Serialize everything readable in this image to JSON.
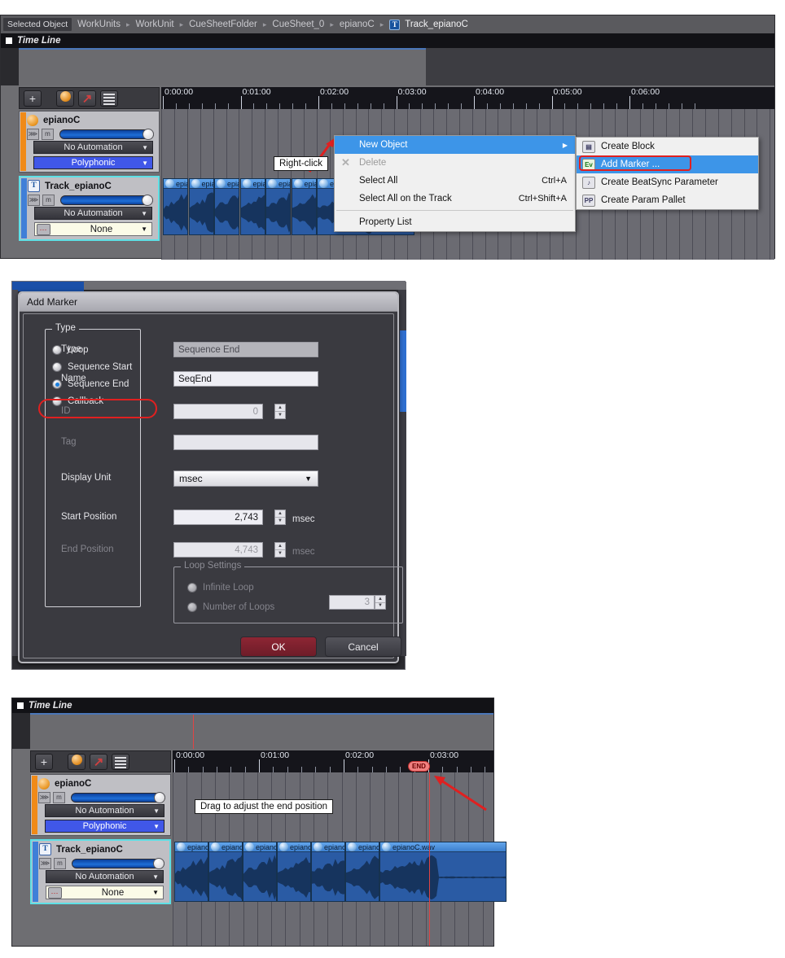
{
  "app": {
    "breadcrumb": {
      "chip": "Selected Object",
      "items": [
        "WorkUnits",
        "WorkUnit",
        "CueSheetFolder",
        "CueSheet_0",
        "epianoC"
      ],
      "separator": "▸",
      "current_icon": "T",
      "current": "Track_epianoC"
    },
    "timeline_title": "Time Line"
  },
  "toolbar": {
    "add_label": "+",
    "buttons": [
      "add-button",
      "voice-ball-button",
      "envelope-button",
      "list-button"
    ]
  },
  "ruler_top": {
    "labels": [
      "0:00:00",
      "0:01:00",
      "0:02:00",
      "0:03:00",
      "0:04:00",
      "0:05:00",
      "0:06:00"
    ]
  },
  "ruler_bottom": {
    "labels": [
      "0:00:00",
      "0:01:00",
      "0:02:00",
      "0:03:00"
    ]
  },
  "tracks_top": [
    {
      "name": "epianoC",
      "icon": "voice-ball-icon",
      "accent": "#f08a18",
      "automation": "No Automation",
      "mode": "Polyphonic",
      "mode_style": "blue",
      "selected": false
    },
    {
      "name": "Track_epianoC",
      "icon": "track-T-icon",
      "accent": "#3f7fd8",
      "automation": "No Automation",
      "mode": "None",
      "mode_style": "cream",
      "selected": true
    }
  ],
  "tracks_bottom": [
    {
      "name": "epianoC",
      "icon": "voice-ball-icon",
      "accent": "#f08a18",
      "automation": "No Automation",
      "mode": "Polyphonic",
      "mode_style": "blue",
      "selected": false
    },
    {
      "name": "Track_epianoC",
      "icon": "track-T-icon",
      "accent": "#3f7fd8",
      "automation": "No Automation",
      "mode": "None",
      "mode_style": "cream",
      "selected": true
    }
  ],
  "clips": {
    "short_label": "epianoC.wav",
    "full_label": "epianoC.wav"
  },
  "context_menu": {
    "items": [
      {
        "label": "New Object",
        "accel": "",
        "submenu": true,
        "highlight": true,
        "disabled": false
      },
      {
        "label": "Delete",
        "accel": "",
        "submenu": false,
        "highlight": false,
        "disabled": true
      },
      {
        "label": "Select All",
        "accel": "Ctrl+A",
        "submenu": false,
        "highlight": false,
        "disabled": false
      },
      {
        "label": "Select All on the Track",
        "accel": "Ctrl+Shift+A",
        "submenu": false,
        "highlight": false,
        "disabled": false
      },
      {
        "label": "Property List",
        "accel": "",
        "submenu": false,
        "highlight": false,
        "disabled": false
      }
    ],
    "submenu": [
      {
        "label": "Create Block",
        "icon": "block-icon",
        "icon_text": "▤",
        "highlight": false
      },
      {
        "label": "Add Marker ...",
        "icon": "marker-icon",
        "icon_text": "Ev",
        "highlight": true
      },
      {
        "label": "Create BeatSync Parameter",
        "icon": "beatsync-icon",
        "icon_text": "♪",
        "highlight": false
      },
      {
        "label": "Create Param Pallet",
        "icon": "param-pallet-icon",
        "icon_text": "PP",
        "highlight": false
      }
    ]
  },
  "callouts": {
    "right_click": "Right-click",
    "drag_end": "Drag to adjust the end position",
    "end_flag": "END"
  },
  "dialog": {
    "title": "Add Marker",
    "type_group": {
      "legend": "Type",
      "options": [
        {
          "label": "Loop",
          "selected": false
        },
        {
          "label": "Sequence Start",
          "selected": false
        },
        {
          "label": "Sequence End",
          "selected": true
        },
        {
          "label": "Callback",
          "selected": false
        }
      ]
    },
    "fields": [
      {
        "label": "Type",
        "value": "Sequence End",
        "state": "readonly",
        "unit": ""
      },
      {
        "label": "Name",
        "value": "SeqEnd",
        "state": "editable",
        "unit": ""
      },
      {
        "label": "ID",
        "value": "0",
        "state": "disabled",
        "unit": "",
        "spinner": true
      },
      {
        "label": "Tag",
        "value": "",
        "state": "disabled",
        "unit": ""
      },
      {
        "label": "Display Unit",
        "value": "msec",
        "state": "combo",
        "unit": ""
      },
      {
        "label": "Start Position",
        "value": "2,743",
        "state": "editable",
        "unit": "msec",
        "spinner": true
      },
      {
        "label": "End Position",
        "value": "4,743",
        "state": "disabled",
        "unit": "msec",
        "spinner": true
      }
    ],
    "loop_settings": {
      "legend": "Loop Settings",
      "options": [
        {
          "label": "Infinite Loop",
          "selected": false
        },
        {
          "label": "Number of Loops",
          "selected": false
        }
      ],
      "loop_count": "3"
    },
    "buttons": {
      "ok": "OK",
      "cancel": "Cancel"
    }
  },
  "colors": {
    "highlight": "#3d95e8",
    "annotation_red": "#e02020",
    "ok_button": "#8d2634",
    "track_selected_border": "#5ee0e6",
    "playhead": "#e04444"
  }
}
